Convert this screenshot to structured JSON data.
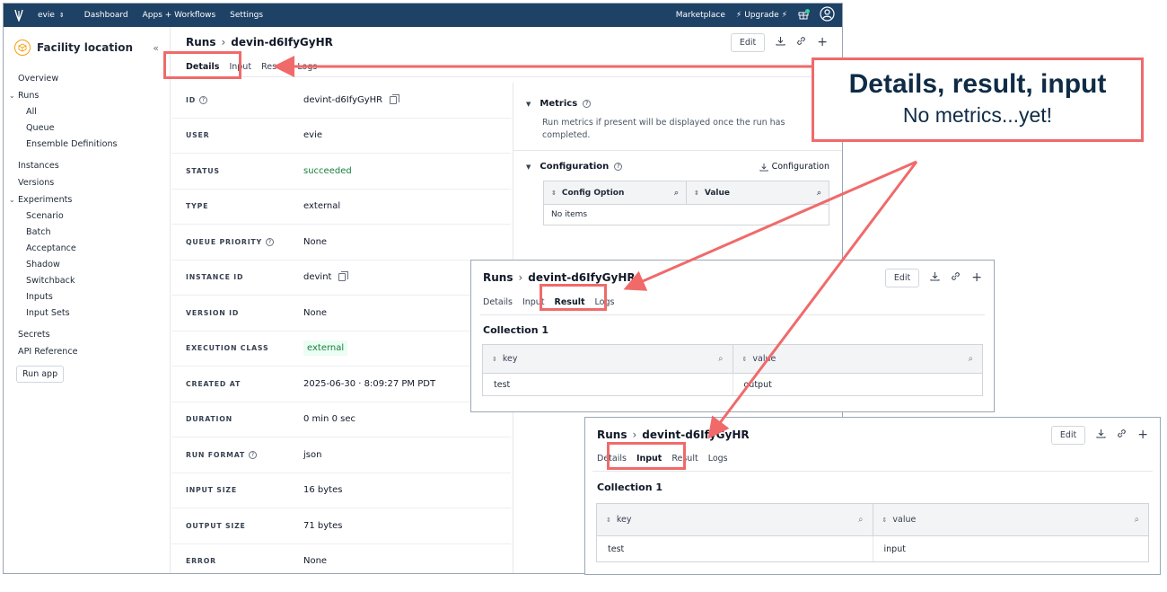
{
  "topnav": {
    "account": "evie",
    "links": [
      "Dashboard",
      "Apps + Workflows",
      "Settings"
    ],
    "marketplace": "Marketplace",
    "upgrade": "Upgrade"
  },
  "sidebar": {
    "app_name": "Facility location",
    "overview": "Overview",
    "runs": "Runs",
    "runs_children": [
      "All",
      "Queue",
      "Ensemble Definitions"
    ],
    "instances": "Instances",
    "versions": "Versions",
    "experiments": "Experiments",
    "experiments_children": [
      "Scenario",
      "Batch",
      "Acceptance",
      "Shadow",
      "Switchback",
      "Inputs",
      "Input Sets"
    ],
    "secrets": "Secrets",
    "api_reference": "API Reference",
    "run_app": "Run app"
  },
  "main": {
    "breadcrumb_root": "Runs",
    "run_id": "devin-d6IfyGyHR",
    "edit": "Edit",
    "tabs": [
      "Details",
      "Input",
      "Result",
      "Logs"
    ],
    "details": [
      {
        "label": "ID",
        "value": "devint-d6IfyGyHR"
      },
      {
        "label": "USER",
        "value": "evie"
      },
      {
        "label": "STATUS",
        "value": "succeeded"
      },
      {
        "label": "TYPE",
        "value": "external"
      },
      {
        "label": "QUEUE PRIORITY",
        "value": "None"
      },
      {
        "label": "INSTANCE ID",
        "value": "devint"
      },
      {
        "label": "VERSION ID",
        "value": "None"
      },
      {
        "label": "EXECUTION CLASS",
        "value": "external"
      },
      {
        "label": "CREATED AT",
        "value": "2025-06-30 · 8:09:27 PM PDT"
      },
      {
        "label": "DURATION",
        "value": "0 min 0 sec"
      },
      {
        "label": "RUN FORMAT",
        "value": "json"
      },
      {
        "label": "INPUT SIZE",
        "value": "16 bytes"
      },
      {
        "label": "OUTPUT SIZE",
        "value": "71 bytes"
      },
      {
        "label": "ERROR",
        "value": "None"
      }
    ],
    "metrics_title": "Metrics",
    "metrics_text": "Run metrics if present will be displayed once the run has completed.",
    "config_title": "Configuration",
    "config_download": "Configuration",
    "config_columns": [
      "Config Option",
      "Value"
    ],
    "config_empty": "No items"
  },
  "result_window": {
    "breadcrumb_root": "Runs",
    "run_id": "devint-d6IfyGyHR",
    "edit": "Edit",
    "tabs": [
      "Details",
      "Input",
      "Result",
      "Logs"
    ],
    "collection": "Collection 1",
    "columns": [
      "key",
      "value"
    ],
    "row": [
      "test",
      "output"
    ]
  },
  "input_window": {
    "breadcrumb_root": "Runs",
    "run_id": "devint-d6IfyGyHR",
    "edit": "Edit",
    "tabs": [
      "Details",
      "Input",
      "Result",
      "Logs"
    ],
    "collection": "Collection 1",
    "columns": [
      "key",
      "value"
    ],
    "row": [
      "test",
      "input"
    ]
  },
  "callout": {
    "headline": "Details, result, input",
    "subline": "No metrics...yet!"
  },
  "colors": {
    "nav": "#1e4166",
    "highlight": "#f06a6a",
    "success": "#15803d",
    "callout_text": "#0f2b46"
  }
}
